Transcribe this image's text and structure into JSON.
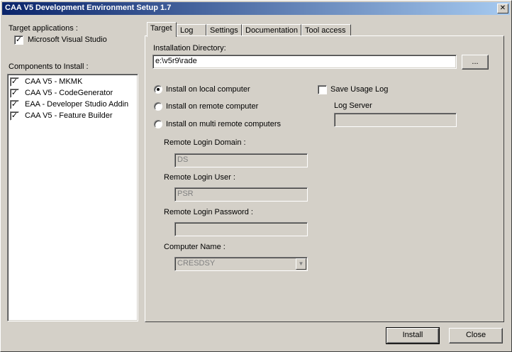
{
  "window": {
    "title": "CAA V5 Development Environment Setup 1.7",
    "close_glyph": "✕"
  },
  "left": {
    "target_applications_label": "Target applications :",
    "target_applications": [
      {
        "label": "Microsoft Visual Studio",
        "checked": true
      }
    ],
    "components_label": "Components to Install :",
    "components": [
      {
        "label": "CAA V5 - MKMK",
        "checked": true
      },
      {
        "label": "CAA V5 - CodeGenerator",
        "checked": true
      },
      {
        "label": "EAA - Developer Studio Addin",
        "checked": true
      },
      {
        "label": "CAA V5 - Feature Builder",
        "checked": true
      }
    ]
  },
  "tabs": [
    "Target",
    "Log",
    "Settings",
    "Documentation",
    "Tool access"
  ],
  "active_tab": "Target",
  "target": {
    "install_dir_label": "Installation Directory:",
    "install_dir_value": "e:\\v5r9\\rade",
    "browse_label": "...",
    "install_options": [
      {
        "label": "Install on local computer",
        "selected": true
      },
      {
        "label": "Install on remote computer",
        "selected": false
      },
      {
        "label": "Install on multi remote computers",
        "selected": false
      }
    ],
    "remote_domain_label": "Remote Login Domain :",
    "remote_domain_value": "DS",
    "remote_user_label": "Remote Login User :",
    "remote_user_value": "PSR",
    "remote_password_label": "Remote Login Password :",
    "remote_password_value": "",
    "computer_name_label": "Computer Name :",
    "computer_name_value": "CRESDSY",
    "save_usage_log_label": "Save Usage Log",
    "save_usage_log_checked": false,
    "log_server_label": "Log Server",
    "log_server_value": ""
  },
  "footer": {
    "install_label": "Install",
    "close_label": "Close"
  },
  "icons": {
    "check_glyph": "✓",
    "dropdown_glyph": "▼"
  },
  "colors": {
    "title_start": "#0a246a",
    "title_end": "#a6caf0",
    "face": "#d4d0c8"
  }
}
